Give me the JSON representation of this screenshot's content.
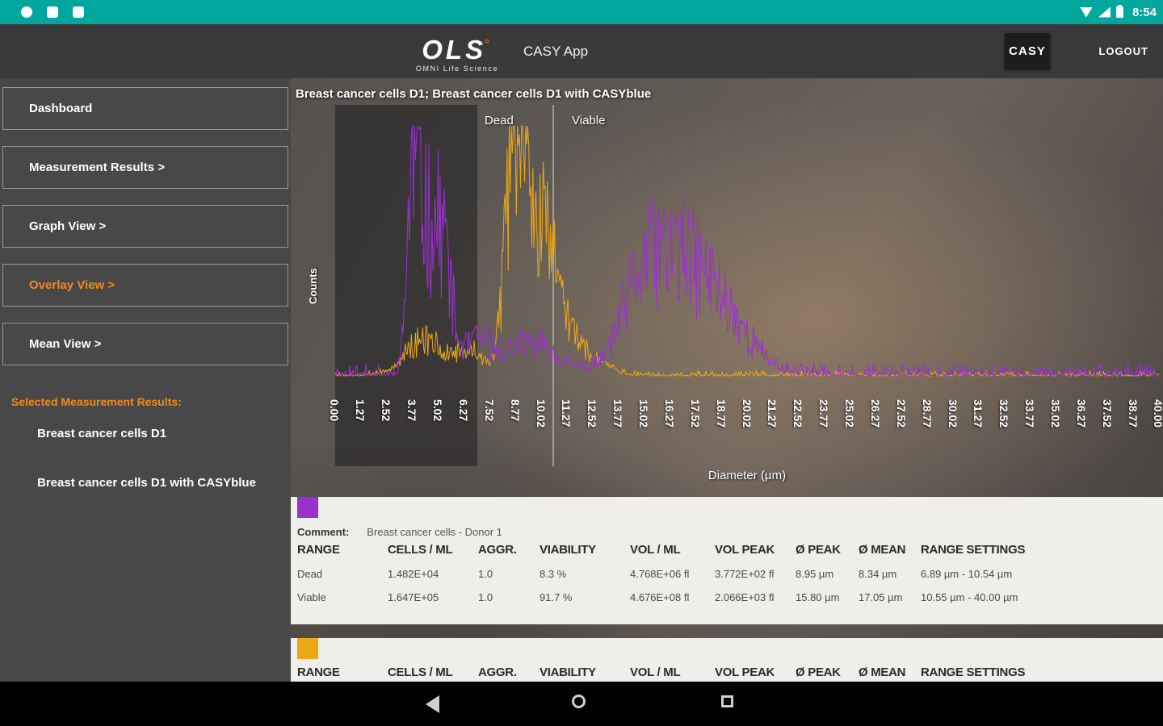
{
  "status_bar": {
    "time": "8:54"
  },
  "header": {
    "logo_main": "OLS",
    "logo_mark": "°",
    "logo_sub": "OMNI Life Science",
    "app_title": "CASY App",
    "casy_button": "CASY",
    "logout_label": "LOGOUT"
  },
  "sidebar": {
    "items": [
      {
        "label": "Dashboard",
        "active": false
      },
      {
        "label": "Measurement Results >",
        "active": false
      },
      {
        "label": "Graph View >",
        "active": false
      },
      {
        "label": "Overlay View >",
        "active": true
      },
      {
        "label": "Mean View >",
        "active": false
      }
    ],
    "selected_heading": "Selected Measurement Results:",
    "selected_items": [
      "Breast cancer cells D1",
      "Breast cancer cells D1 with CASYblue"
    ]
  },
  "chart": {
    "type": "overlay-histogram",
    "title": "Breast cancer cells D1; Breast cancer cells D1 with CASYblue",
    "ylabel": "Counts",
    "xlabel": "Diameter (µm)",
    "region_labels": {
      "dead": "Dead",
      "viable": "Viable"
    },
    "x_max": 40,
    "shade_end_um": 6.89,
    "cursor_um": 10.55,
    "x_ticks": [
      "0.00",
      "1.27",
      "2.52",
      "3.77",
      "5.02",
      "6.27",
      "7.52",
      "8.77",
      "10.02",
      "11.27",
      "12.52",
      "13.77",
      "15.02",
      "16.27",
      "17.52",
      "18.77",
      "20.02",
      "21.27",
      "22.52",
      "23.77",
      "25.02",
      "26.27",
      "27.52",
      "28.77",
      "30.02",
      "31.27",
      "32.52",
      "33.77",
      "35.02",
      "36.27",
      "37.52",
      "38.77",
      "40.00"
    ],
    "series": [
      {
        "key": "breast-cancer-cells-d1",
        "name": "Breast cancer cells D1",
        "color": "#9b30d0",
        "seed": 11,
        "noise": 0.5,
        "base": 0.05,
        "peaks": [
          {
            "c": 3.65,
            "h": 0.45,
            "w": 0.22
          },
          {
            "c": 4.05,
            "h": 0.58,
            "w": 0.35
          },
          {
            "c": 4.85,
            "h": 0.5,
            "w": 0.45
          },
          {
            "c": 5.4,
            "h": 0.25,
            "w": 0.3
          },
          {
            "c": 6.8,
            "h": 0.12,
            "w": 0.8
          },
          {
            "c": 9.5,
            "h": 0.12,
            "w": 1.2
          },
          {
            "c": 14.8,
            "h": 0.2,
            "w": 1.0
          },
          {
            "c": 16.2,
            "h": 0.33,
            "w": 1.4
          },
          {
            "c": 18.4,
            "h": 0.26,
            "w": 1.5
          }
        ]
      },
      {
        "key": "breast-cancer-cells-d1-casyblue",
        "name": "Breast cancer cells D1 with CASYblue",
        "color": "#eaa817",
        "seed": 5,
        "noise": 0.45,
        "base": 0.02,
        "peaks": [
          {
            "c": 8.8,
            "h": 0.78,
            "w": 0.45
          },
          {
            "c": 9.5,
            "h": 0.5,
            "w": 0.8
          },
          {
            "c": 10.6,
            "h": 0.25,
            "w": 0.7
          },
          {
            "c": 4.3,
            "h": 0.14,
            "w": 0.9
          },
          {
            "c": 6.5,
            "h": 0.1,
            "w": 0.6
          },
          {
            "c": 12.2,
            "h": 0.07,
            "w": 0.9
          }
        ]
      }
    ]
  },
  "tables": [
    {
      "swatch_color": "#9b30d0",
      "comment_label": "Comment:",
      "comment": "Breast cancer cells - Donor 1",
      "headers": [
        "RANGE",
        "CELLS / ML",
        "AGGR.",
        "VIABILITY",
        "VOL / ML",
        "VOL PEAK",
        "Ø PEAK",
        "Ø MEAN",
        "RANGE SETTINGS"
      ],
      "rows": [
        [
          "Dead",
          "1.482E+04",
          "1.0",
          "8.3 %",
          "4.768E+06 fl",
          "3.772E+02 fl",
          "8.95 µm",
          "8.34 µm",
          "6.89 µm - 10.54 µm"
        ],
        [
          "Viable",
          "1.647E+05",
          "1.0",
          "91.7 %",
          "4.676E+08 fl",
          "2.066E+03 fl",
          "15.80 µm",
          "17.05 µm",
          "10.55 µm - 40.00 µm"
        ]
      ]
    },
    {
      "swatch_color": "#eaa817",
      "comment_label": "",
      "comment": "",
      "headers": [
        "RANGE",
        "CELLS / ML",
        "AGGR.",
        "VIABILITY",
        "VOL / ML",
        "VOL PEAK",
        "Ø PEAK",
        "Ø MEAN",
        "RANGE SETTINGS"
      ],
      "rows": []
    }
  ]
}
